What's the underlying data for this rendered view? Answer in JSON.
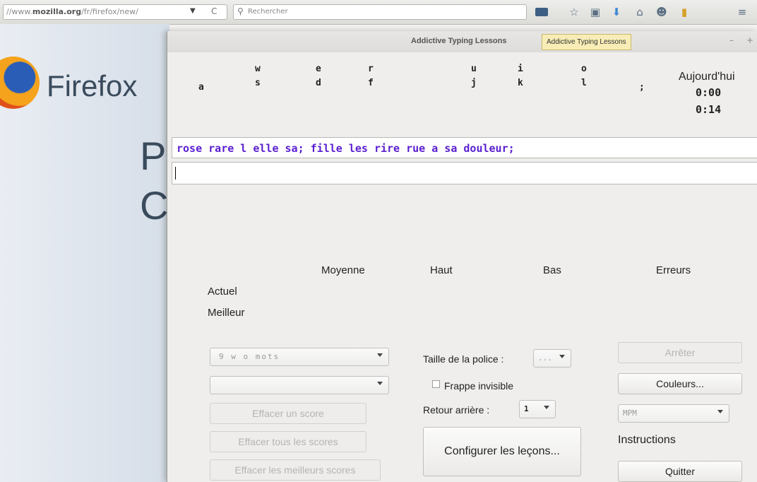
{
  "browser": {
    "url_prefix": "//www.",
    "url_domain": "mozilla.org",
    "url_path": "/fr/firefox/new/",
    "search_placeholder": "Rechercher"
  },
  "firefox_page": {
    "brand": "Firefox",
    "heading_line1": "P",
    "heading_line2": "C"
  },
  "window": {
    "title": "Addictive Typing Lessons",
    "tooltip": "Addictive Typing Lessons"
  },
  "keyboard": {
    "top_row": [
      "w",
      "e",
      "r",
      "u",
      "i",
      "o"
    ],
    "home_row": [
      "a",
      "s",
      "d",
      "f",
      "j",
      "k",
      "l",
      ";"
    ]
  },
  "stats": {
    "today_label": "Aujourd'hui",
    "time_today": "0:00",
    "time_session": "0:14"
  },
  "lesson": {
    "text": "rose rare l elle sa; fille les rire rue a sa douleur;",
    "typed": ""
  },
  "scores": {
    "col_average": "Moyenne",
    "col_high": "Haut",
    "col_low": "Bas",
    "col_errors": "Erreurs",
    "row_current": "Actuel",
    "row_best": "Meilleur"
  },
  "controls": {
    "lesson_combo": "9 w o mots",
    "second_combo": "",
    "clear_score": "Effacer un score",
    "clear_all": "Effacer tous les scores",
    "clear_best": "Effacer les meilleurs scores",
    "font_size_label": "Taille de la police :",
    "font_size_value": "...",
    "invisible_label": "Frappe invisible",
    "backspace_label": "Retour arrière :",
    "backspace_value": "1",
    "configure": "Configurer les leçons...",
    "stop": "Arrêter",
    "colors": "Couleurs...",
    "speed_unit": "MPM",
    "instructions": "Instructions",
    "quit": "Quitter"
  }
}
